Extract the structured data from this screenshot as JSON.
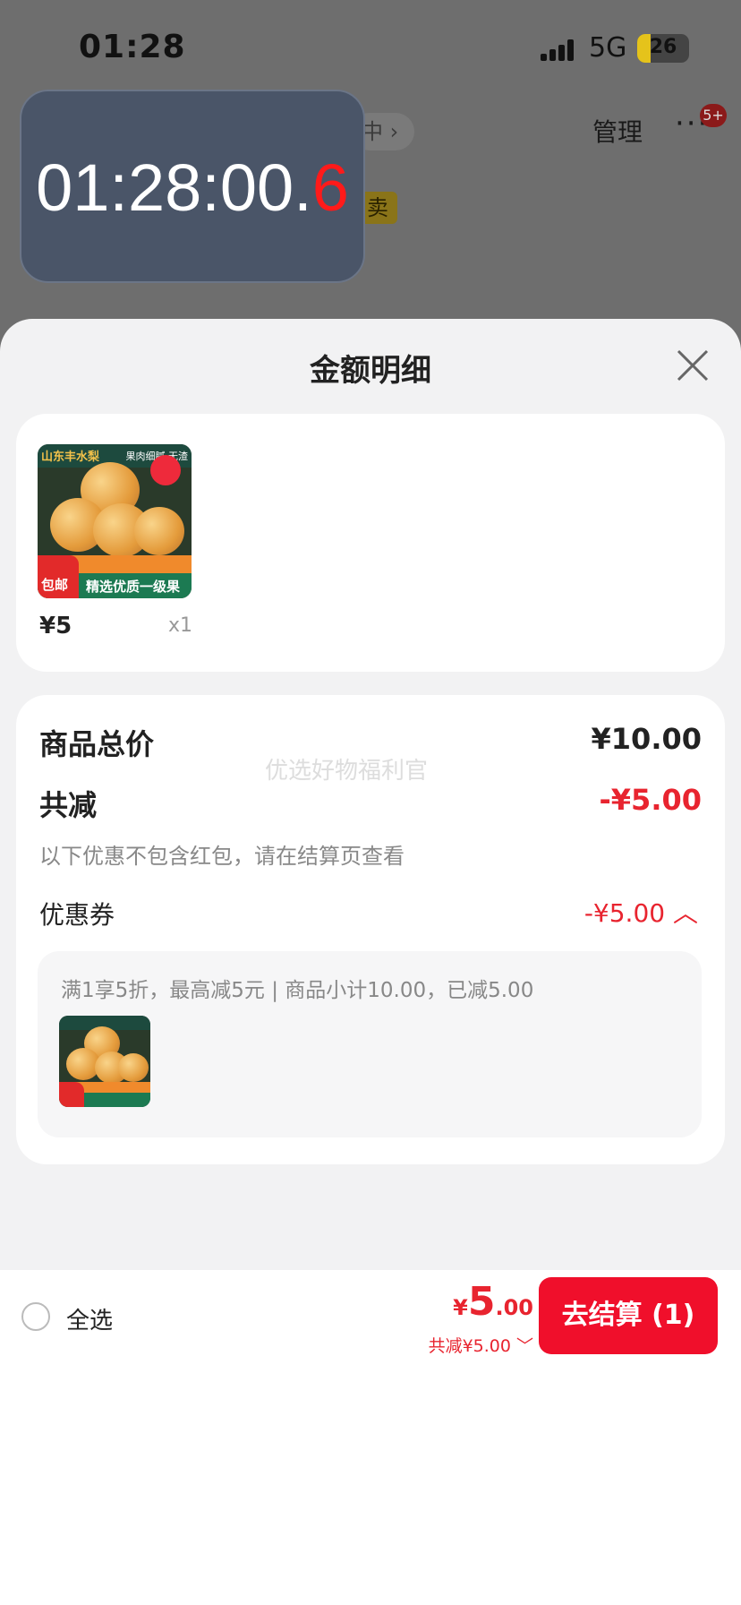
{
  "status_bar": {
    "time": "01:28",
    "network": "5G",
    "battery": "26",
    "battery_level": 0.26
  },
  "background": {
    "chip_text": "中 ›",
    "manage": "管理",
    "more": "···",
    "badge": "5+",
    "tag": "卖"
  },
  "timer": {
    "main": "01:28:00.",
    "last": "6"
  },
  "sheet": {
    "title": "金额明细",
    "close_icon": "close-icon",
    "item": {
      "price": "¥5",
      "qty": "x1"
    },
    "thumb": {
      "top_left": "山东丰水梨",
      "top_right": "果肉细腻 无渣",
      "bottom": "精选优质一级果",
      "badge": "包邮"
    },
    "summary": {
      "total_label": "商品总价",
      "total_value": "¥10.00",
      "reduce_label": "共减",
      "reduce_value": "-¥5.00",
      "note": "以下优惠不包含红包，请在结算页查看",
      "watermark": "优选好物福利官",
      "coupon_label": "优惠券",
      "coupon_value": "-¥5.00 ︿",
      "coupon_desc": "满1享5折，最高减5元 | 商品小计10.00，已减5.00"
    }
  },
  "bottom_bar": {
    "select_all": "全选",
    "currency": "¥",
    "total_int": "5",
    "total_dec": ".00",
    "reduced": "共减¥5.00 ﹀",
    "checkout": "去结算 (1)"
  },
  "colors": {
    "accent_red": "#f00f2b",
    "price_red": "#e8242f",
    "timer_bg": "#4a5568"
  }
}
